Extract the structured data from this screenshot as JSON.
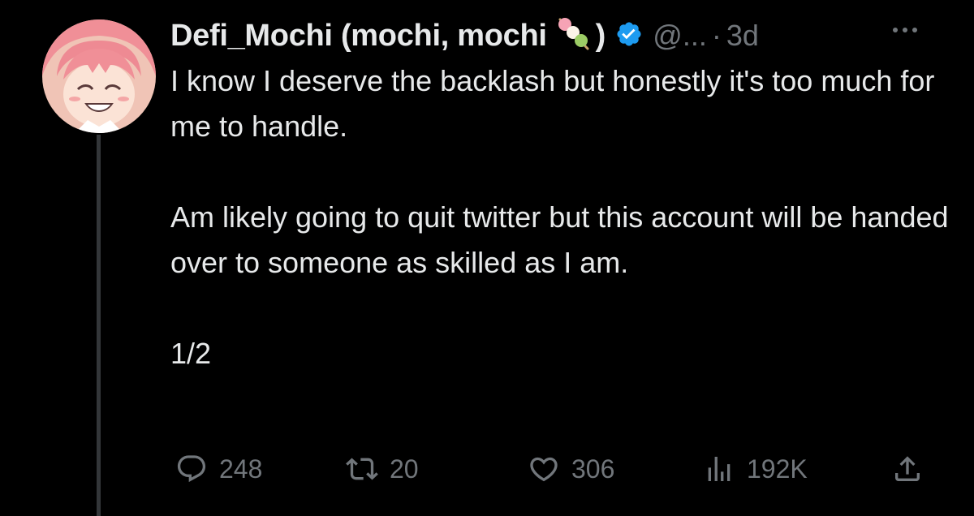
{
  "tweet": {
    "author": {
      "display_name": "Defi_Mochi (mochi, mochi",
      "display_name_emoji": "dango-icon",
      "display_name_suffix": ")",
      "verified": true,
      "handle": "@...",
      "separator": "·",
      "time_ago": "3d"
    },
    "body": {
      "paragraph_1": "I know I deserve the backlash but honestly it's too much for me to handle.",
      "paragraph_2": "Am likely going to quit twitter but this account will be handed over to someone as skilled as I am.",
      "paragraph_3": "1/2"
    },
    "actions": {
      "replies": "248",
      "reposts": "20",
      "likes": "306",
      "views": "192K"
    }
  },
  "icons": {
    "reply": "reply-icon",
    "repost": "repost-icon",
    "like": "like-icon",
    "views": "views-icon",
    "share": "share-icon",
    "more": "more-icon",
    "verified": "verified-badge-icon"
  },
  "colors": {
    "background": "#000000",
    "text_primary": "#e7e9ea",
    "text_secondary": "#71767b",
    "verified_blue": "#1d9bf0",
    "thread_line": "#333639"
  }
}
